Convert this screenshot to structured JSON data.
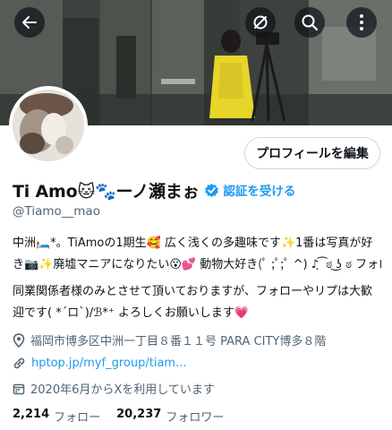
{
  "topbar": {
    "back_icon": "back-arrow-icon",
    "hide_icon": "eye-off-icon",
    "search_icon": "search-icon",
    "more_icon": "more-vertical-icon"
  },
  "profile": {
    "display_name": "Ti Amo🐱🐾ーノ瀬まぉ",
    "verify_label": "認証を受ける",
    "handle": "@Tiamo__mao",
    "edit_button": "プロフィールを編集"
  },
  "bio": {
    "line1": "中洲🛏️*。TiAmoの1期生🥰 広く浅くの多趣味です✨1番は写真が好",
    "line2": "き📷✨廃墟マニアになりたい😮💕 動物大好き(ﾟ ;ﾟ;ﾟ ^) ♪ฺ ͡ ಠ ͜ʖ ಠ フォロバは",
    "line3": "同業関係者様のみとさせて頂いておりますが、フォローやリプは大歓",
    "line4": "迎です( *´ロ`)/ℬ*⁺ よろしくお願いします💗"
  },
  "meta": {
    "location": "福岡市博多区中洲一丁目８番１１号 PARA CITY博多８階",
    "website": "hptop.jp/myf_group/tiam...",
    "joined": "2020年6月からXを利用しています"
  },
  "stats": {
    "following_count": "2,214",
    "following_label": "フォロー",
    "followers_count": "20,237",
    "followers_label": "フォロワー"
  },
  "colors": {
    "accent": "#1d9bf0",
    "secondary_text": "#536471",
    "primary_text": "#0f1419"
  }
}
